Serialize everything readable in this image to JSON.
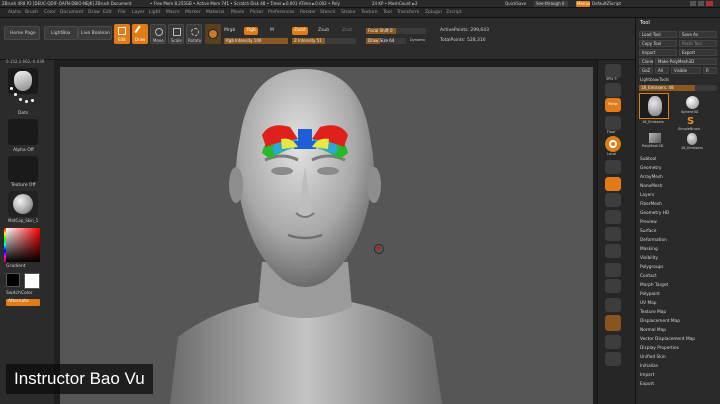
{
  "titlebar": {
    "title": "ZBrush 4R8 P2 [DEUC-QDIF-QAFN-DBIO-NEJK] ZBrush Document",
    "mem": "• Free Mem 8.255GB • Active Mem 741 • Scratch Disk 48 • Timer ►0.001 ATime ►0.002 • Poly",
    "kp": "24 KP • MeshCount ►2",
    "quicksave": "QuickSave",
    "seethrough": "See-through 0",
    "menus_label": "Menus",
    "script": "DefaultZScript"
  },
  "menubar": [
    "Alpha",
    "Brush",
    "Color",
    "Document",
    "Draw",
    "Edit",
    "File",
    "Layer",
    "Light",
    "Macro",
    "Marker",
    "Material",
    "Movie",
    "Picker",
    "Preferences",
    "Render",
    "Stencil",
    "Stroke",
    "Texture",
    "Tool",
    "Transform",
    "Zplugin",
    "Zscript"
  ],
  "topshelf": {
    "home_page": "Home Page",
    "lightbox": "LightBox",
    "live_boolean": "Live Boolean",
    "edit": "Edit",
    "draw": "Draw",
    "move": "Move",
    "scale": "Scale",
    "rotate": "Rotate",
    "mrgb": "Mrgb",
    "rgb": "Rgb",
    "m": "M",
    "zadd": "Zadd",
    "zsub": "Zsub",
    "zcut": "Zcut",
    "rgb_intensity": "Rgb Intensity 100",
    "z_intensity": "Z Intensity 51",
    "focal_shift": "Focal Shift 0",
    "draw_size": "Draw Size 64",
    "dynamic": "Dynamic",
    "active_points": "ActivePoints: 299,643",
    "total_points": "TotalPoints: 528,316"
  },
  "coords": "0.152,1.662,-0.039",
  "leftshelf": {
    "brush_label": "Move",
    "stroke_label": "Dots",
    "alpha_label": "Alpha Off",
    "texture_label": "Texture Off",
    "material_label": "MatCap_Skin_1",
    "gradient": "Gradient",
    "switchcolor": "SwitchColor",
    "alternate": "Alternate"
  },
  "rightshelf": [
    "SPix 3",
    "Dynamic",
    "Persp",
    "Floor",
    "Local",
    "L.Sym",
    "Xpose",
    "Frame",
    "Move",
    "Zoom3D",
    "Rotate",
    "Line Fill",
    "PolyF",
    "Transp",
    "Ghost",
    "Solo",
    "Xpose"
  ],
  "toolpanel": {
    "title": "Tool",
    "buttons": [
      [
        "Load Tool",
        "Save As"
      ],
      [
        "Copy Tool",
        "Paste Tool"
      ],
      [
        "Import",
        "Export"
      ],
      [
        "Clone",
        "Make PolyMesh3D"
      ],
      [
        "GoZ",
        "All",
        "Visible",
        "R"
      ]
    ],
    "lightbox_tools": "Lightbox▸Tools",
    "current_tool": "18_Emissers. 48",
    "thumbs": [
      "18_Emissers",
      "Sphere3D",
      "SimpleBrush",
      "PolyMesh3D",
      "18_Emissers"
    ],
    "subpalettes": [
      "Subtool",
      "Geometry",
      "ArrayMesh",
      "NanoMesh",
      "Layers",
      "FiberMesh",
      "Geometry HD",
      "Preview",
      "Surface",
      "Deformation",
      "Masking",
      "Visibility",
      "Polygroups",
      "Contact",
      "Morph Target",
      "Polypaint",
      "UV Map",
      "Texture Map",
      "Displacement Map",
      "Normal Map",
      "Vector Displacement Map",
      "Display Properties",
      "Unified Skin",
      "Initialize",
      "Import",
      "Export"
    ]
  },
  "caption": "Instructor Bao Vu",
  "colors": {
    "accent": "#e07b15",
    "panel": "#2a2a2a",
    "canvas": "#565656"
  }
}
